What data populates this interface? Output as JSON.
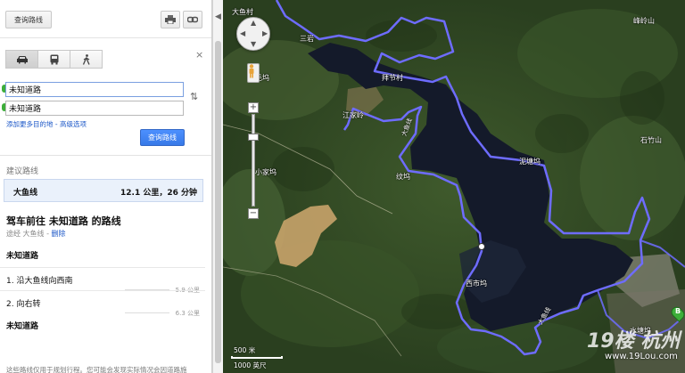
{
  "header": {
    "get_directions": "查询路线"
  },
  "travel_modes": [
    "driving-icon",
    "transit-icon",
    "walking-icon"
  ],
  "close": "×",
  "inputs": {
    "from": "未知道路",
    "to": "未知道路"
  },
  "links": {
    "add_destination": "添加更多目的地",
    "separator": " - ",
    "advanced": "高级选项"
  },
  "search_button": "查询路线",
  "suggested": {
    "heading": "建议路线",
    "route_name": "大鱼线",
    "route_stats": "12.1 公里，26 分钟"
  },
  "directions": {
    "title": "驾车前往 未知道路 的路线",
    "via_prefix": "途经 大鱼线 - ",
    "remove": "删除",
    "start": "未知道路",
    "steps": [
      {
        "text": "1. 沿大鱼线向西南",
        "distance": "5.9 公里"
      },
      {
        "text": "2. 向右转",
        "distance": "6.3 公里"
      }
    ],
    "end": "未知道路",
    "footer_note": "这些路线仅用于规划行程。您可能会发现实际情况会因道路施"
  },
  "map": {
    "places": {
      "dayu_top": "大鱼村",
      "sanyan": "三岩",
      "yangmao": "杨毛坞",
      "baijie": "拜节村",
      "jiangjialing": "江家岭",
      "fengling": "峰岭山",
      "xiaojia": "小家坞",
      "nitang": "泥塘坞",
      "shizhu": "石竹山",
      "wenwu": "纹坞",
      "xishi": "西市坞",
      "shuitang": "水塘坞",
      "road_label_1": "大鱼线",
      "road_label_2": "大鱼线"
    },
    "marker_b": "B",
    "scale_metric": "500 米",
    "scale_imperial": "1000 英尺",
    "watermark_logo": "19楼 杭州",
    "watermark_url": "www.19Lou.com"
  },
  "colors": {
    "route": "#6e6cff",
    "primary_button": "#4d90fe",
    "link": "#1a56c7",
    "marker": "#3dae3a"
  }
}
